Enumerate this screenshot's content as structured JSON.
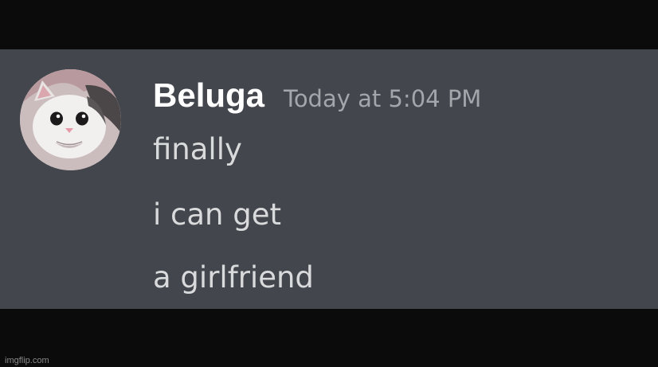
{
  "message": {
    "author": "Beluga",
    "timestamp": "Today at 5:04 PM",
    "lines": [
      "finally",
      "i can get",
      "a girlfriend"
    ]
  },
  "avatar_icon": "cat-face-avatar",
  "watermark": "imgflip.com",
  "colors": {
    "background_bars": "#0b0b0c",
    "message_panel": "#43464c",
    "username": "#ffffff",
    "timestamp": "#a3a6ab",
    "message_text": "#d9dadc"
  }
}
